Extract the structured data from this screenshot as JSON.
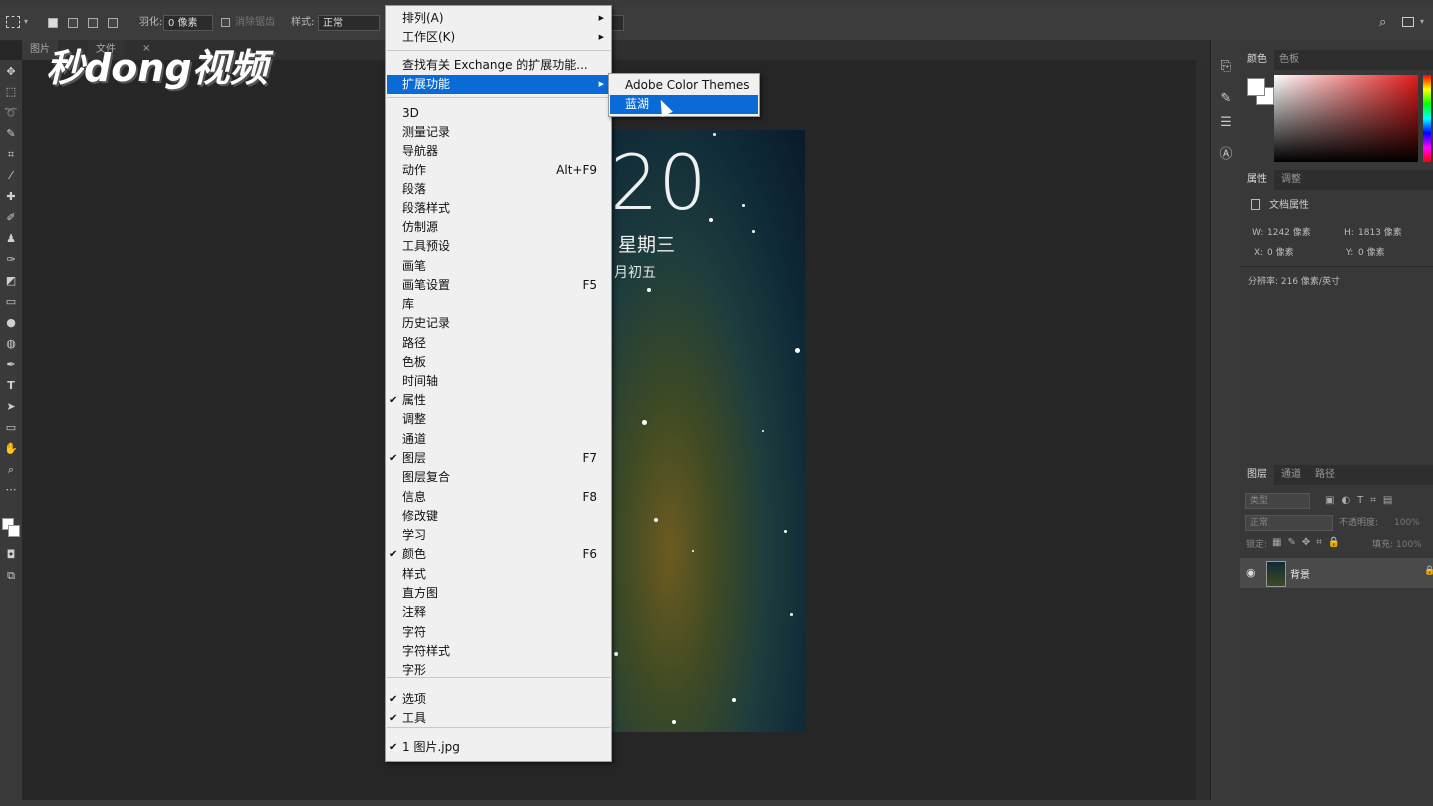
{
  "watermark": {
    "text": "秒dong视频"
  },
  "options_bar": {
    "feather_label": "羽化:",
    "feather_value": "0 像素",
    "antialias_label": "消除锯齿",
    "style_label": "样式:",
    "style_value": "正常"
  },
  "document_tabs": [
    {
      "label": "图片"
    },
    {
      "label": "文件"
    }
  ],
  "document_image": {
    "time_partial": "20",
    "weekday": "星期三",
    "lunar_partial": "月初五"
  },
  "window_menu": {
    "items": [
      {
        "label": "排列(A)",
        "submenu": true
      },
      {
        "label": "工作区(K)",
        "submenu": true
      },
      {
        "label": "查找有关 Exchange 的扩展功能..."
      },
      {
        "label": "扩展功能",
        "submenu": true,
        "highlighted": true
      },
      {
        "label": "3D"
      },
      {
        "label": "测量记录"
      },
      {
        "label": "导航器"
      },
      {
        "label": "动作",
        "shortcut": "Alt+F9"
      },
      {
        "label": "段落"
      },
      {
        "label": "段落样式"
      },
      {
        "label": "仿制源"
      },
      {
        "label": "工具预设"
      },
      {
        "label": "画笔"
      },
      {
        "label": "画笔设置",
        "shortcut": "F5"
      },
      {
        "label": "库"
      },
      {
        "label": "历史记录"
      },
      {
        "label": "路径"
      },
      {
        "label": "色板"
      },
      {
        "label": "时间轴"
      },
      {
        "label": "属性",
        "checked": true
      },
      {
        "label": "调整"
      },
      {
        "label": "通道"
      },
      {
        "label": "图层",
        "checked": true,
        "shortcut": "F7"
      },
      {
        "label": "图层复合"
      },
      {
        "label": "信息",
        "shortcut": "F8"
      },
      {
        "label": "修改键"
      },
      {
        "label": "学习"
      },
      {
        "label": "颜色",
        "checked": true,
        "shortcut": "F6"
      },
      {
        "label": "样式"
      },
      {
        "label": "直方图"
      },
      {
        "label": "注释"
      },
      {
        "label": "字符"
      },
      {
        "label": "字符样式"
      },
      {
        "label": "字形"
      },
      {
        "label": "选项",
        "checked": true
      },
      {
        "label": "工具",
        "checked": true
      },
      {
        "label": "1 图片.jpg",
        "checked": true
      }
    ],
    "check_mark": "✔",
    "submenu_arrow": "▶"
  },
  "extensions_submenu": {
    "items": [
      {
        "label": "Adobe Color Themes"
      },
      {
        "label": "蓝湖",
        "highlighted": true
      }
    ]
  },
  "panels": {
    "color_tabs": [
      "颜色",
      "色板"
    ],
    "properties_tabs": [
      "属性",
      "调整"
    ],
    "doc_properties_title": "文档属性",
    "w_label": "W:",
    "w_value": "1242 像素",
    "h_label": "H:",
    "h_value": "1813 像素",
    "x_label": "X:",
    "x_value": "0 像素",
    "y_label": "Y:",
    "y_value": "0 像素",
    "resolution": "分辨率: 216 像素/英寸",
    "layers_tabs": [
      "图层",
      "通道",
      "路径"
    ],
    "layer_filter": "类型",
    "blend_mode": "正常",
    "opacity_label": "不透明度:",
    "opacity_value": "100%",
    "lock_label": "锁定:",
    "fill_label": "填充:",
    "fill_value": "100%",
    "layer_name": "背景"
  }
}
